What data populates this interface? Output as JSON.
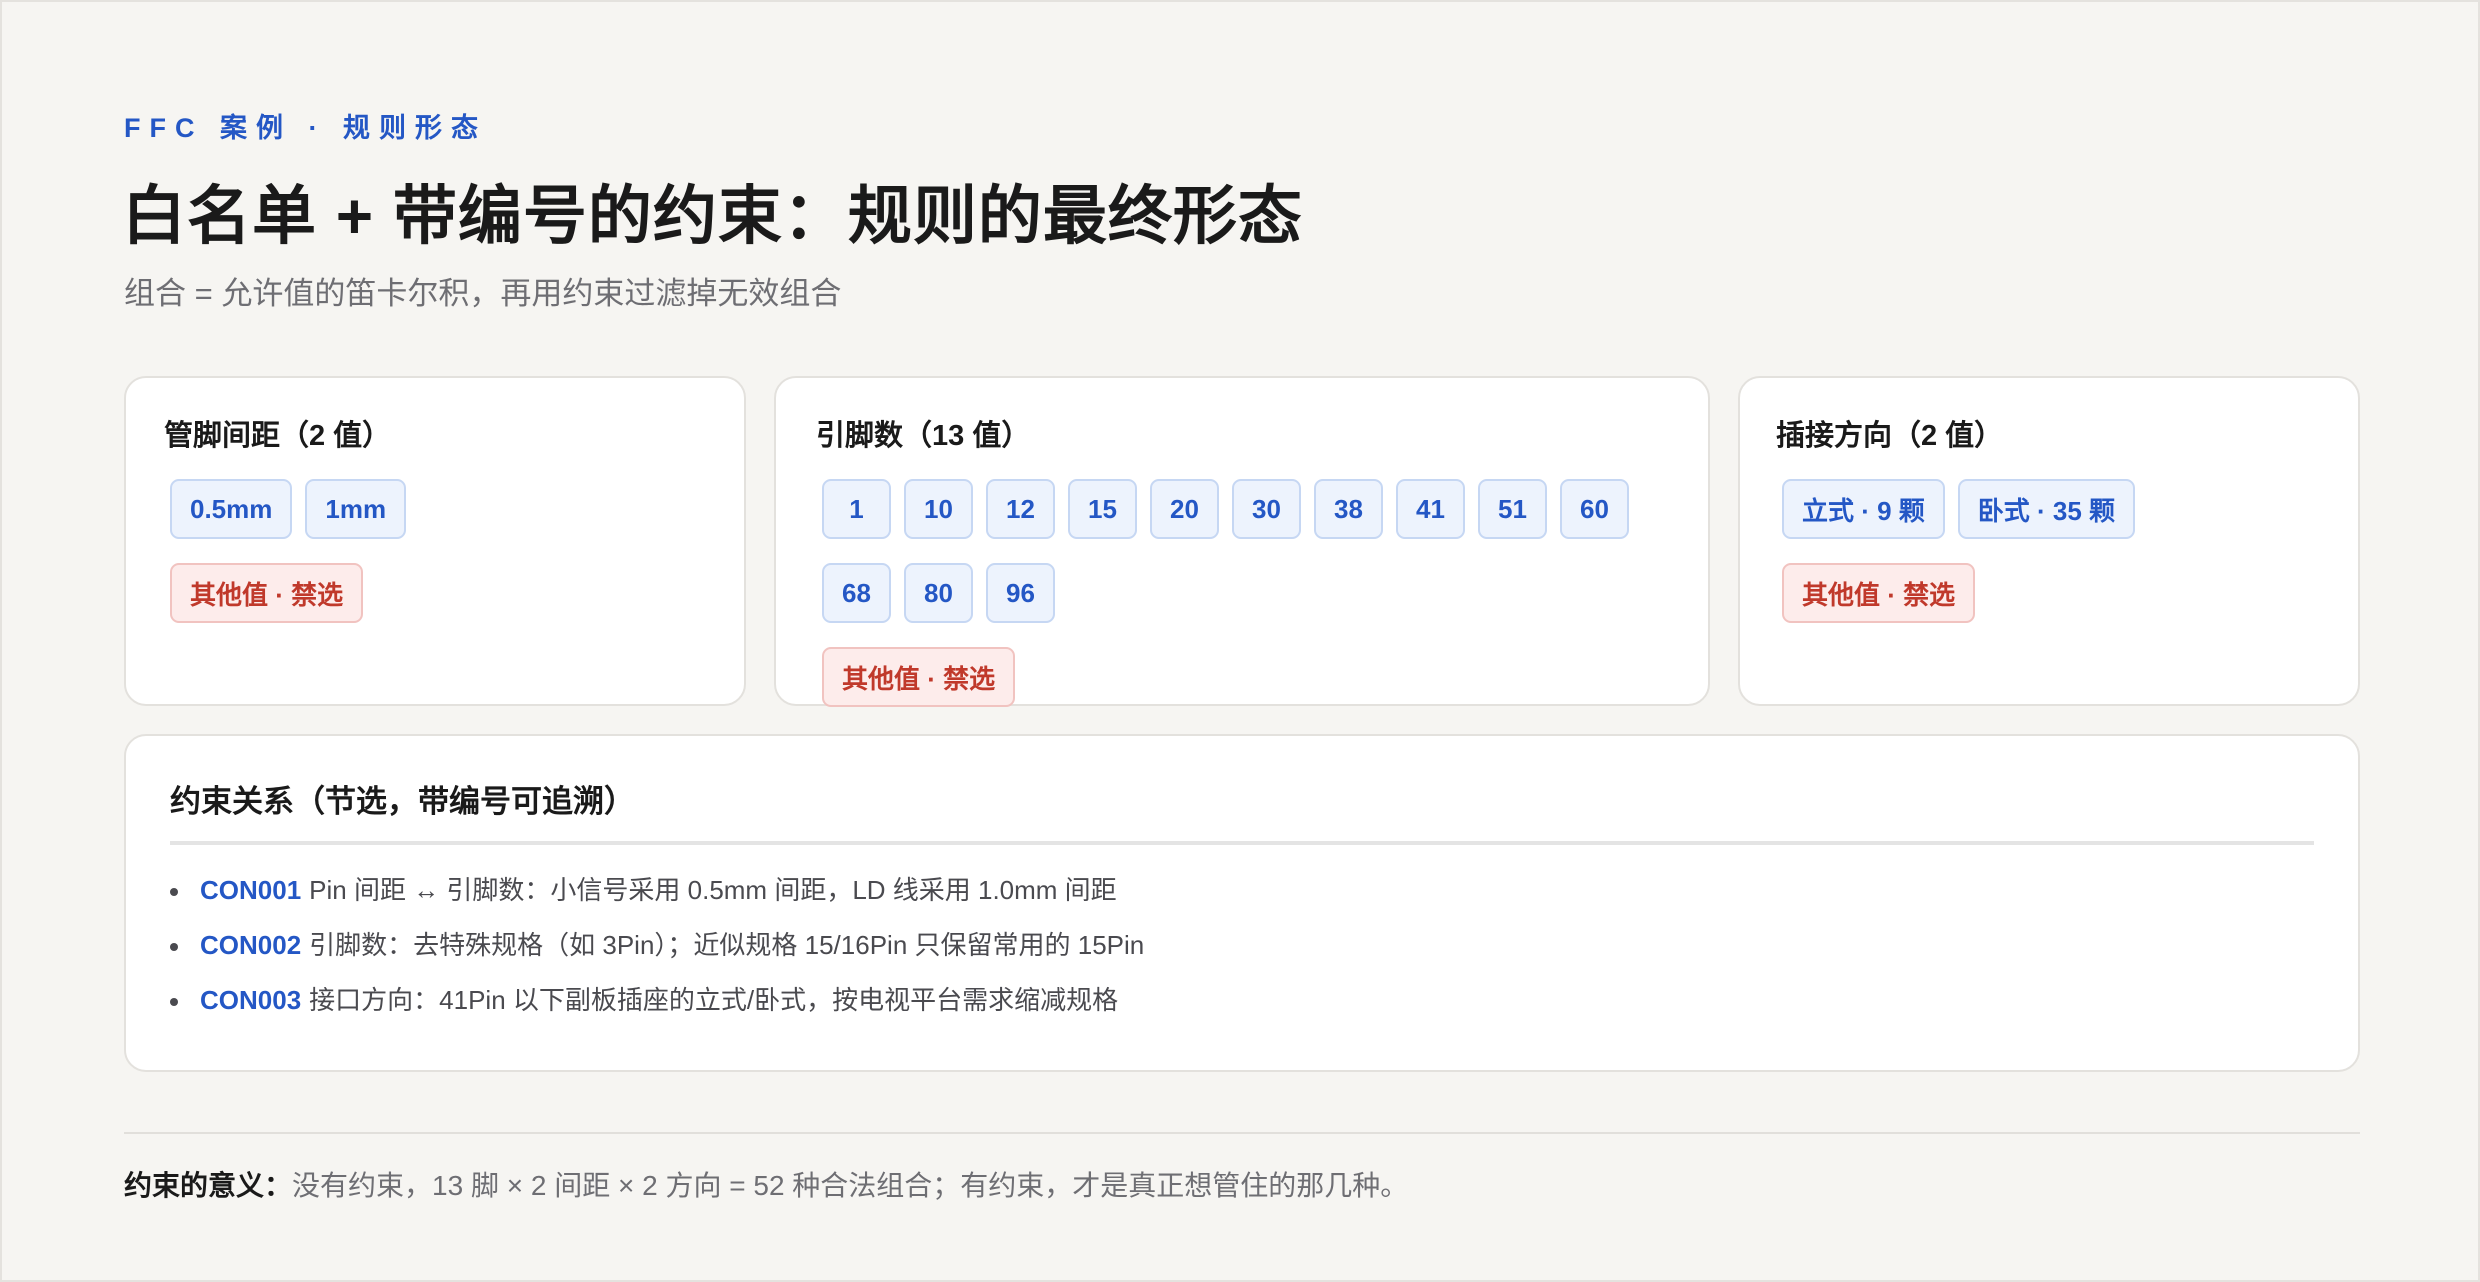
{
  "header": {
    "eyebrow": "FFC 案例 · 规则形态",
    "title": "白名单 + 带编号的约束：规则的最终形态",
    "subtitle": "组合 = 允许值的笛卡尔积，再用约束过滤掉无效组合"
  },
  "pitch": {
    "title": "管脚间距（2 值）",
    "values": [
      "0.5mm",
      "1mm"
    ],
    "forbidden": "其他值 · 禁选"
  },
  "pins": {
    "title": "引脚数（13 值）",
    "values": [
      "1",
      "10",
      "12",
      "15",
      "20",
      "30",
      "38",
      "41",
      "51",
      "60",
      "68",
      "80",
      "96"
    ],
    "forbidden": "其他值 · 禁选"
  },
  "orientation": {
    "title": "插接方向（2 值）",
    "values": [
      "立式 · 9 颗",
      "卧式 · 35 颗"
    ],
    "forbidden": "其他值 · 禁选"
  },
  "constraints": {
    "title": "约束关系（节选，带编号可追溯）",
    "items": [
      {
        "code": "CON001",
        "text": "Pin 间距 ↔ 引脚数：小信号采用 0.5mm 间距，LD 线采用 1.0mm 间距"
      },
      {
        "code": "CON002",
        "text": "引脚数：去特殊规格（如 3Pin）；近似规格 15/16Pin 只保留常用的 15Pin"
      },
      {
        "code": "CON003",
        "text": "接口方向：41Pin 以下副板插座的立式/卧式，按电视平台需求缩减规格"
      }
    ]
  },
  "footer": {
    "label": "约束的意义：",
    "text": "没有约束，13 脚 × 2 间距 × 2 方向 = 52 种合法组合；有约束，才是真正想管住的那几种。"
  },
  "colors": {
    "accent": "#2457c5",
    "allowed_bg": "#edf3fd",
    "forbidden_text": "#c0392b",
    "forbidden_bg": "#fdeceb"
  }
}
